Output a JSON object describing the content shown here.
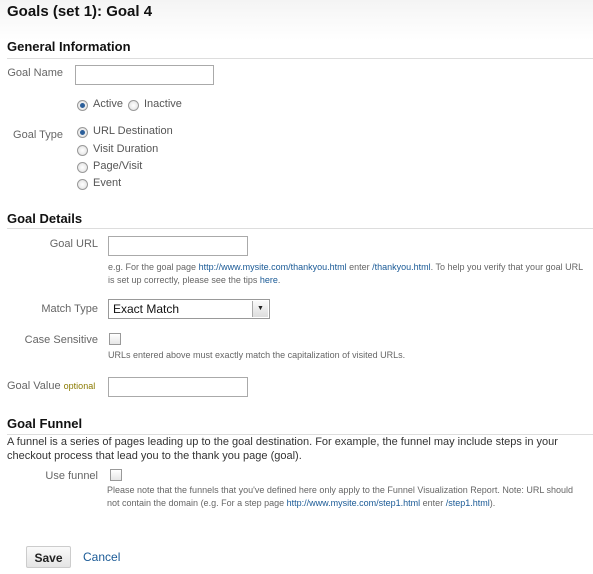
{
  "title": "Goals (set 1): Goal 4",
  "general": {
    "heading": "General Information",
    "goal_name_label": "Goal Name",
    "goal_name_value": "",
    "status_options": [
      {
        "label": "Active",
        "selected": true
      },
      {
        "label": "Inactive",
        "selected": false
      }
    ],
    "goal_type_label": "Goal Type",
    "goal_types": [
      {
        "label": "URL Destination",
        "selected": true
      },
      {
        "label": "Visit Duration",
        "selected": false
      },
      {
        "label": "Page/Visit",
        "selected": false
      },
      {
        "label": "Event",
        "selected": false
      }
    ]
  },
  "details": {
    "heading": "Goal Details",
    "goal_url_label": "Goal URL",
    "goal_url_value": "",
    "help_1": "e.g. For the goal page ",
    "help_link_1": "http://www.mysite.com/thankyou.html",
    "help_2": " enter ",
    "help_link_2": "/thankyou.html",
    "help_3": ". To help you verify that your goal URL is set up correctly, please see the tips ",
    "help_link_3": "here",
    "help_4": ".",
    "match_type_label": "Match Type",
    "match_type_value": "Exact Match",
    "case_sensitive_label": "Case Sensitive",
    "case_sensitive_checked": false,
    "case_help": "URLs entered above must exactly match the capitalization of visited URLs.",
    "goal_value_label": "Goal Value",
    "goal_value_optional": "optional",
    "goal_value_value": ""
  },
  "funnel": {
    "heading": "Goal Funnel",
    "description": "A funnel is a series of pages leading up to the goal destination. For example, the funnel may include steps in your checkout process that lead you to the thank you page (goal).",
    "use_funnel_label": "Use funnel",
    "use_funnel_checked": false,
    "note_1": "Please note that the funnels that you've defined here only apply to the Funnel Visualization Report. Note: URL should not contain the domain (e.g. For a step page ",
    "note_link_1": "http://www.mysite.com/step1.html",
    "note_2": " enter ",
    "note_link_2": "/step1.html",
    "note_3": ")."
  },
  "actions": {
    "save": "Save",
    "cancel": "Cancel"
  },
  "colors": {
    "link": "#1a5a96",
    "radio_selected": "#2c5f9a",
    "optional": "#8a7a00"
  }
}
